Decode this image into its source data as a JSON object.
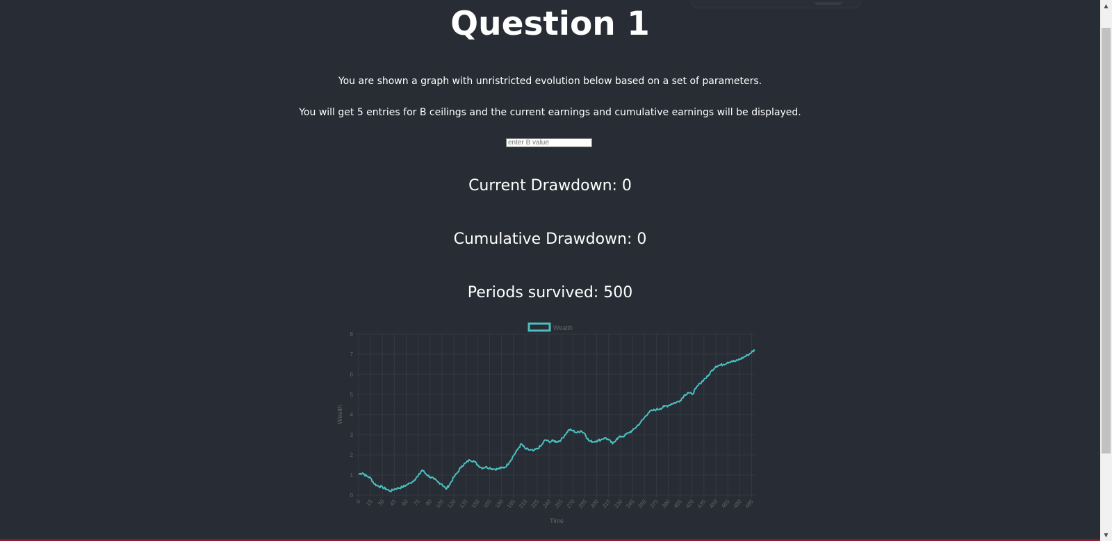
{
  "page": {
    "title": "Question 1",
    "intro_text": "You are shown a graph with unristricted evolution below based on a set of parameters.",
    "instructions_text": "You will get 5 entries for B ceilings and the current earnings and cumulative earnings will be displayed.",
    "b_input": {
      "placeholder": "enter B value",
      "value": ""
    },
    "current_drawdown": "Current Drawdown: 0",
    "cumulative_drawdown": "Cumulative Drawdown: 0",
    "periods_survived": "Periods survived: 500"
  },
  "colors": {
    "background": "#282c34",
    "text": "#ffffff",
    "series_line": "#4bc0c0",
    "axis_text": "#666666",
    "grid": "#353a42"
  },
  "chart_data": {
    "type": "line",
    "legend": {
      "label": "Wealth",
      "placement": "top-center"
    },
    "xlabel": "Time",
    "ylabel": "Wealth",
    "x_range": [
      0,
      499
    ],
    "x_tick_step": 15,
    "y_range": [
      0,
      8
    ],
    "y_ticks": [
      0,
      1,
      2,
      3,
      4,
      5,
      6,
      7,
      8
    ],
    "grid": true,
    "series": [
      {
        "name": "Wealth",
        "points": [
          [
            0,
            1.05
          ],
          [
            5,
            1.1
          ],
          [
            10,
            0.95
          ],
          [
            15,
            0.85
          ],
          [
            20,
            0.55
          ],
          [
            25,
            0.45
          ],
          [
            30,
            0.4
          ],
          [
            35,
            0.3
          ],
          [
            40,
            0.2
          ],
          [
            45,
            0.3
          ],
          [
            50,
            0.35
          ],
          [
            55,
            0.4
          ],
          [
            60,
            0.5
          ],
          [
            65,
            0.6
          ],
          [
            70,
            0.75
          ],
          [
            75,
            0.95
          ],
          [
            80,
            1.25
          ],
          [
            85,
            1.05
          ],
          [
            90,
            0.9
          ],
          [
            95,
            0.8
          ],
          [
            100,
            0.65
          ],
          [
            105,
            0.55
          ],
          [
            110,
            0.3
          ],
          [
            115,
            0.55
          ],
          [
            120,
            0.9
          ],
          [
            125,
            1.15
          ],
          [
            130,
            1.45
          ],
          [
            135,
            1.6
          ],
          [
            140,
            1.75
          ],
          [
            145,
            1.7
          ],
          [
            150,
            1.5
          ],
          [
            155,
            1.35
          ],
          [
            160,
            1.4
          ],
          [
            165,
            1.35
          ],
          [
            170,
            1.3
          ],
          [
            175,
            1.3
          ],
          [
            180,
            1.35
          ],
          [
            185,
            1.4
          ],
          [
            190,
            1.65
          ],
          [
            195,
            1.95
          ],
          [
            200,
            2.25
          ],
          [
            205,
            2.55
          ],
          [
            210,
            2.3
          ],
          [
            215,
            2.25
          ],
          [
            220,
            2.2
          ],
          [
            225,
            2.3
          ],
          [
            230,
            2.45
          ],
          [
            235,
            2.75
          ],
          [
            240,
            2.65
          ],
          [
            245,
            2.7
          ],
          [
            250,
            2.65
          ],
          [
            255,
            2.75
          ],
          [
            260,
            3.0
          ],
          [
            265,
            3.25
          ],
          [
            270,
            3.2
          ],
          [
            275,
            3.1
          ],
          [
            280,
            3.2
          ],
          [
            285,
            3.05
          ],
          [
            290,
            2.7
          ],
          [
            295,
            2.65
          ],
          [
            300,
            2.7
          ],
          [
            305,
            2.75
          ],
          [
            310,
            2.85
          ],
          [
            315,
            2.75
          ],
          [
            320,
            2.55
          ],
          [
            325,
            2.8
          ],
          [
            330,
            2.9
          ],
          [
            335,
            2.95
          ],
          [
            340,
            3.1
          ],
          [
            345,
            3.2
          ],
          [
            350,
            3.4
          ],
          [
            355,
            3.6
          ],
          [
            360,
            3.85
          ],
          [
            365,
            4.1
          ],
          [
            370,
            4.2
          ],
          [
            375,
            4.25
          ],
          [
            380,
            4.3
          ],
          [
            385,
            4.4
          ],
          [
            390,
            4.45
          ],
          [
            395,
            4.55
          ],
          [
            400,
            4.6
          ],
          [
            405,
            4.7
          ],
          [
            410,
            4.95
          ],
          [
            415,
            5.1
          ],
          [
            420,
            5.0
          ],
          [
            425,
            5.3
          ],
          [
            430,
            5.55
          ],
          [
            435,
            5.75
          ],
          [
            440,
            5.9
          ],
          [
            445,
            6.2
          ],
          [
            450,
            6.4
          ],
          [
            455,
            6.45
          ],
          [
            460,
            6.5
          ],
          [
            465,
            6.6
          ],
          [
            470,
            6.65
          ],
          [
            475,
            6.65
          ],
          [
            480,
            6.75
          ],
          [
            485,
            6.85
          ],
          [
            490,
            6.95
          ],
          [
            495,
            7.1
          ],
          [
            499,
            7.2
          ]
        ]
      }
    ]
  }
}
